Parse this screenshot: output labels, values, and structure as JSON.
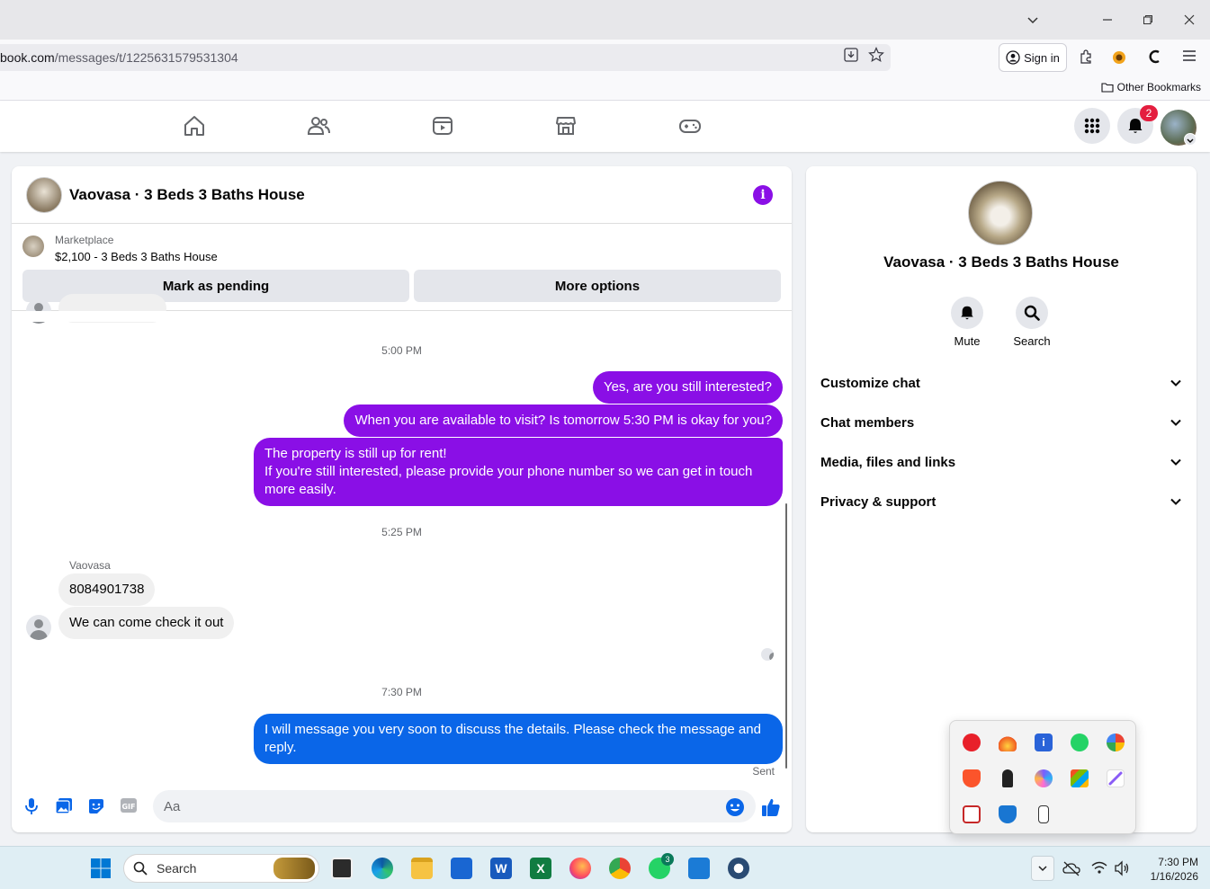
{
  "browser": {
    "url_host": "book.com",
    "url_path": "/messages/t/1225631579531304",
    "signin_label": "Sign in",
    "other_bookmarks": "Other Bookmarks"
  },
  "fbnav": {
    "notifications_count": "2"
  },
  "chat": {
    "title": "Vaovasa · 3 Beds 3 Baths House",
    "marketplace_label": "Marketplace",
    "listing": "$2,100 - 3 Beds 3 Baths House",
    "mark_pending": "Mark as pending",
    "more_options": "More options",
    "time1": "5:00 PM",
    "msg_out1": "Yes, are you still interested?",
    "msg_out2": "When you are available to visit? Is tomorrow 5:30 PM is okay for you?",
    "msg_out3_line1": "The property is still up for rent!",
    "msg_out3_line2": "If you're still interested, please provide your phone number so we can get in touch",
    "msg_out3_line3": "more easily.",
    "time2": "5:25 PM",
    "sender_name": "Vaovasa",
    "msg_in1": "8084901738",
    "msg_in2": "We can come check it out",
    "time3": "7:30 PM",
    "msg_out4_line1": "I will message you very soon to discuss the details. Please check the message and",
    "msg_out4_line2": "reply.",
    "sent_status": "Sent",
    "input_placeholder": "Aa"
  },
  "info_panel": {
    "name": "Vaovasa · 3 Beds 3 Baths House",
    "mute_label": "Mute",
    "search_label": "Search",
    "sections": [
      "Customize chat",
      "Chat members",
      "Media, files and links",
      "Privacy & support"
    ]
  },
  "taskbar": {
    "search_placeholder": "Search",
    "time": "7:30 PM",
    "date": "1/16/2026",
    "whatsapp_badge": "3"
  },
  "colors": {
    "messenger_purple": "#8a0fe6",
    "messenger_blue": "#0a66e8",
    "notif_red": "#e41e3f"
  }
}
